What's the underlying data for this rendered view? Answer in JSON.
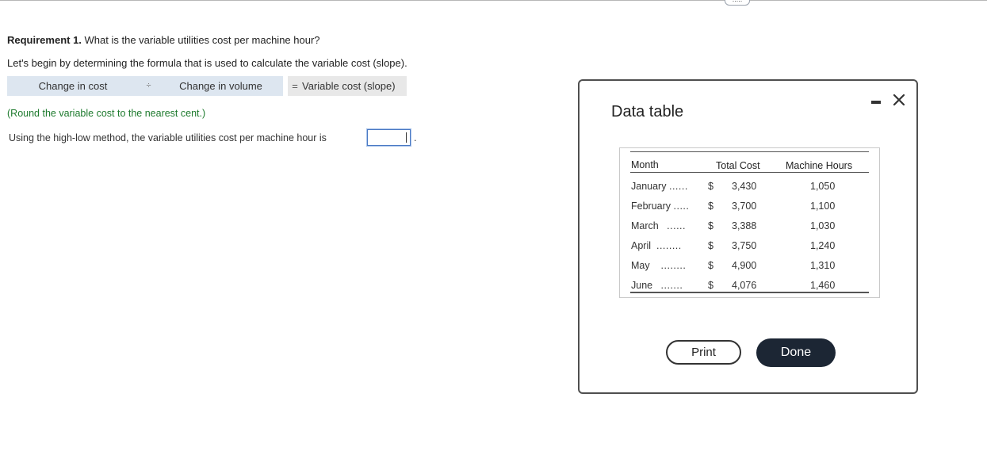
{
  "question": {
    "requirement_label": "Requirement 1.",
    "requirement_text": " What is the variable utilities cost per machine hour?",
    "intro": "Let's begin by determining the formula that is used to calculate the variable cost (slope).",
    "formula": {
      "term1": "Change in cost",
      "divide_symbol": "÷",
      "term2": "Change in volume",
      "equals_symbol": "=",
      "result": "Variable cost (slope)"
    },
    "round_note": "(Round the variable cost to the nearest cent.)",
    "sentence": "Using the high-low method, the variable utilities cost per machine hour is",
    "answer_value": "",
    "trailing_period": "."
  },
  "top_tab": {
    "label": "....."
  },
  "modal": {
    "title": "Data table",
    "minimize_icon": "minimize-icon",
    "close_icon": "close-icon",
    "table": {
      "headers": {
        "month": "Month",
        "total_cost": "Total Cost",
        "machine_hours": "Machine Hours"
      },
      "rows": [
        {
          "month": "January",
          "dots": "......",
          "currency": "$",
          "total_cost": "3,430",
          "machine_hours": "1,050"
        },
        {
          "month": "February",
          "dots": ".....",
          "currency": "$",
          "total_cost": "3,700",
          "machine_hours": "1,100"
        },
        {
          "month": "March",
          "dots": "......",
          "currency": "$",
          "total_cost": "3,388",
          "machine_hours": "1,030"
        },
        {
          "month": "April",
          "dots": "........",
          "currency": "$",
          "total_cost": "3,750",
          "machine_hours": "1,240"
        },
        {
          "month": "May",
          "dots": "........",
          "currency": "$",
          "total_cost": "4,900",
          "machine_hours": "1,310"
        },
        {
          "month": "June",
          "dots": ".......",
          "currency": "$",
          "total_cost": "4,076",
          "machine_hours": "1,460"
        }
      ]
    },
    "buttons": {
      "print": "Print",
      "done": "Done"
    }
  },
  "colors": {
    "formula_bg": "#dde6f0",
    "result_bg": "#e8e8e8",
    "note_green": "#1d7a2d",
    "done_bg": "#1c2634",
    "input_border": "#4a79c4"
  }
}
